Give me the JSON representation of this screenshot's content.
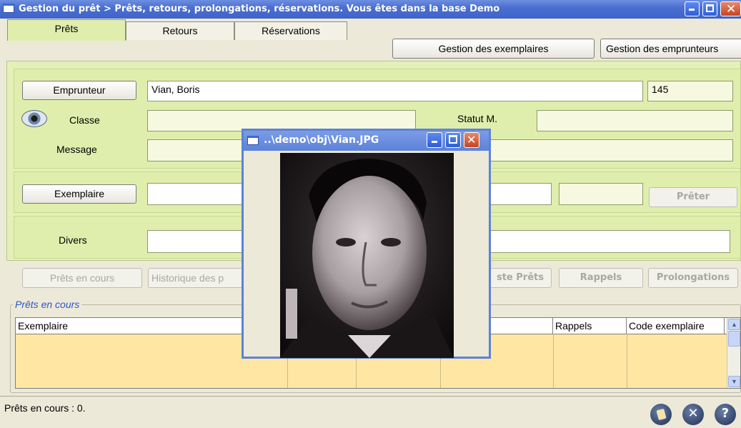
{
  "window": {
    "title": "Gestion du prêt > Prêts, retours, prolongations, réservations.  Vous êtes dans la base Demo"
  },
  "tabs": [
    "Prêts",
    "Retours",
    "Réservations"
  ],
  "top_buttons": {
    "exemplaires": "Gestion des exemplaires",
    "emprunteurs": "Gestion des emprunteurs"
  },
  "borrower": {
    "button": "Emprunteur",
    "name": "Vian, Boris",
    "number": "145",
    "classe_label": "Classe",
    "statut_label": "Statut M.",
    "message_label": "Message"
  },
  "exemplaire": {
    "button": "Exemplaire",
    "preter": "Prêter"
  },
  "divers": {
    "label": "Divers"
  },
  "action_buttons": {
    "prets_en_cours": "Prêts en cours",
    "historique": "Historique des p",
    "liste_prets": "ste Prêts",
    "rappels": "Rappels",
    "prolongations": "Prolongations"
  },
  "loans_section": {
    "title": "Prêts en cours",
    "columns": [
      "Exemplaire",
      "Rappels",
      "Code exemplaire"
    ]
  },
  "status": {
    "text": "Prêts en cours :  0."
  },
  "popup": {
    "title": "..\\demo\\obj\\Vian.JPG"
  },
  "colors": {
    "panel": "#dfeeac",
    "grid": "#ffe7a3",
    "titlebar": "#4a6fd0"
  }
}
